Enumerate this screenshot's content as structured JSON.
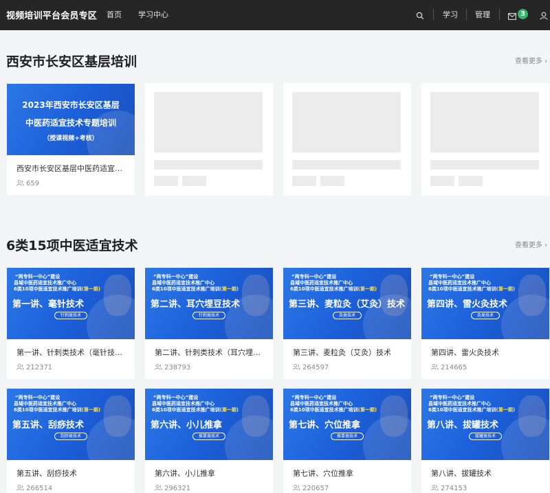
{
  "header": {
    "brand": "视频培训平台会员专区",
    "nav": {
      "home": "首页",
      "learning_center": "学习中心"
    },
    "right": {
      "study": "学习",
      "manage": "管理",
      "message_count": "3"
    }
  },
  "sections": [
    {
      "title": "西安市长安区基层培训",
      "more": "查看更多 ›",
      "card": {
        "thumb_line1": "2023年西安市长安区基层",
        "thumb_line2": "中医药适宜技术专题培训",
        "thumb_line3": "（授课视频+考核）",
        "title": "西安市长安区基层中医药适宜技术专题培训",
        "count": "659"
      }
    },
    {
      "title": "6类15项中医适宜技术",
      "more": "查看更多 ›",
      "thumb_common": {
        "line1": "“两专科一中心”建设",
        "line2": "县域中医药适宜技术推广中心",
        "line3_a": "6类10项中医适宜技术推广培训",
        "line3_b": "(第一期)"
      },
      "cards": [
        {
          "big": "第一讲、毫针技术",
          "pill": "针刺类技术",
          "title": "第一讲、针刺类技术（毫针技术）",
          "count": "212371"
        },
        {
          "big": "第二讲、耳穴埋豆技术",
          "pill": "针刺类技术",
          "title": "第二讲、针刺类技术（耳穴埋豆技术）",
          "count": "238793"
        },
        {
          "big": "第三讲、麦粒灸（艾灸）技术",
          "pill": "灸类技术",
          "title": "第三讲、麦粒灸（艾灸）技术",
          "count": "264597"
        },
        {
          "big": "第四讲、雷火灸技术",
          "pill": "灸类技术",
          "title": "第四讲、雷火灸技术",
          "count": "214665"
        },
        {
          "big": "第五讲、刮痧技术",
          "pill": "刮痧类技术",
          "title": "第五讲、刮痧技术",
          "count": "266514"
        },
        {
          "big": "第六讲、小儿推拿",
          "pill": "推拿类技术",
          "title": "第六讲、小儿推拿",
          "count": "296321"
        },
        {
          "big": "第七讲、穴位推拿",
          "pill": "推拿类技术",
          "title": "第七讲、穴位推拿",
          "count": "220657"
        },
        {
          "big": "第八讲、拔罐技术",
          "pill": "拔罐类技术",
          "title": "第八讲、拔罐技术",
          "count": "274153"
        }
      ]
    }
  ],
  "colors": {
    "header_bg": "#262626",
    "badge": "#2fb76b",
    "thumb_blue": "#1b5ed8",
    "highlight_yellow": "#ffe14d"
  }
}
